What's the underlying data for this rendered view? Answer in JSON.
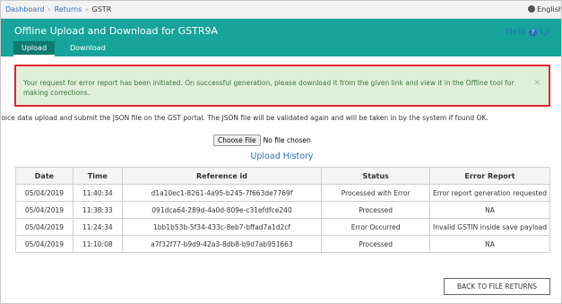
{
  "breadcrumb": {
    "items": [
      "Dashboard",
      "Returns"
    ],
    "current": "GSTR"
  },
  "language": "English",
  "header": {
    "title": "Offline Upload and Download for GSTR9A",
    "tabs": [
      "Upload",
      "Download"
    ],
    "active_tab": "Upload",
    "help_label": "Help"
  },
  "alert": {
    "message": "Your request for error report has been initiated. On successful generation, please download it from the given link and view it in the Offline tool for making corrections.",
    "close_symbol": "×",
    "border_color": "#e1232a",
    "background_color": "#dff0d8"
  },
  "info_text": "voice data upload and submit the JSON file on the GST portal. The JSON file will be validated again and will be taken in by the system if found OK.",
  "file_input": {
    "button_label": "Choose File",
    "status": "No file chosen"
  },
  "history": {
    "title": "Upload History",
    "columns": [
      "Date",
      "Time",
      "Reference id",
      "Status",
      "Error Report"
    ],
    "rows": [
      [
        "05/04/2019",
        "11:40:34",
        "d1a10ec1-8261-4a95-b245-7f663de7769f",
        "Processed with Error",
        "Error report generation requested"
      ],
      [
        "05/04/2019",
        "11:38:33",
        "091dca64-289d-4a0d-809e-c31efdfce240",
        "Processed",
        "NA"
      ],
      [
        "05/04/2019",
        "11:24:34",
        "1bb1b53b-5f34-433c-8eb7-bffad7a1d2cf",
        "Error Occurred",
        "Invalid GSTIN inside save payload"
      ],
      [
        "05/04/2019",
        "11:10:08",
        "a7f32f77-b9d9-42a3-8db8-b9d7ab951663",
        "Processed",
        "NA"
      ]
    ]
  },
  "back_button_label": "BACK TO FILE RETURNS",
  "colors": {
    "header": "#17a49a",
    "link": "#2a6ebb"
  }
}
